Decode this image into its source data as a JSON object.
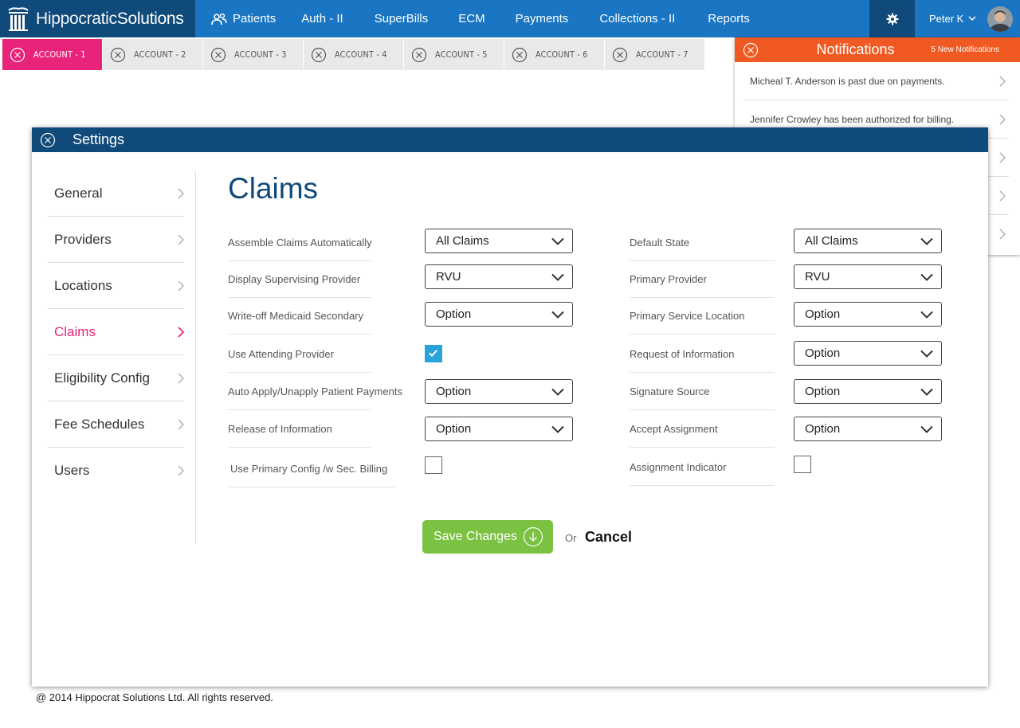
{
  "brand": {
    "name_light": "Hippocratic",
    "name_bold": "Solutions"
  },
  "nav": {
    "items": [
      {
        "label": "Patients",
        "icon": "users-icon"
      },
      {
        "label": "Auth - II"
      },
      {
        "label": "SuperBills"
      },
      {
        "label": "ECM"
      },
      {
        "label": "Payments"
      },
      {
        "label": "Collections - II"
      },
      {
        "label": "Reports"
      }
    ],
    "settings_icon": "gear-icon",
    "user_name": "Peter K"
  },
  "account_tabs": [
    {
      "label": "ACCOUNT - 1",
      "active": true
    },
    {
      "label": "ACCOUNT - 2"
    },
    {
      "label": "ACCOUNT - 3"
    },
    {
      "label": "ACCOUNT - 4"
    },
    {
      "label": "ACCOUNT - 5"
    },
    {
      "label": "ACCOUNT - 6"
    },
    {
      "label": "ACCOUNT - 7"
    }
  ],
  "notifications": {
    "title": "Notifications",
    "count_label": "5 New Notifications",
    "items": [
      "Micheal T. Anderson is past due on payments.",
      "Jennifer Crowley has been authorized for billing.",
      "",
      "",
      ""
    ]
  },
  "settings": {
    "title": "Settings",
    "menu": [
      {
        "label": "General"
      },
      {
        "label": "Providers"
      },
      {
        "label": "Locations"
      },
      {
        "label": "Claims",
        "active": true
      },
      {
        "label": "Eligibility Config"
      },
      {
        "label": "Fee Schedules"
      },
      {
        "label": "Users"
      }
    ],
    "heading": "Claims",
    "left_fields": [
      {
        "label": "Assemble Claims Automatically",
        "type": "select",
        "value": "All Claims"
      },
      {
        "label": "Display Supervising Provider",
        "type": "select",
        "value": "RVU"
      },
      {
        "label": "Write-off Medicaid Secondary",
        "type": "select",
        "value": "Option"
      },
      {
        "label": "Use Attending Provider",
        "type": "checkbox",
        "checked": true
      },
      {
        "label": "Auto Apply/Unapply Patient Payments",
        "type": "select",
        "value": "Option"
      },
      {
        "label": "Release of Information",
        "type": "select",
        "value": "Option"
      },
      {
        "label": "Use Primary Config /w Sec. Billing",
        "type": "checkbox",
        "checked": false
      }
    ],
    "right_fields": [
      {
        "label": "Default State",
        "type": "select",
        "value": "All Claims"
      },
      {
        "label": "Primary Provider",
        "type": "select",
        "value": "RVU"
      },
      {
        "label": "Primary Service Location",
        "type": "select",
        "value": "Option"
      },
      {
        "label": "Request of Information",
        "type": "select",
        "value": "Option"
      },
      {
        "label": "Signature Source",
        "type": "select",
        "value": "Option"
      },
      {
        "label": "Accept Assignment",
        "type": "select",
        "value": "Option"
      },
      {
        "label": "Assignment Indicator",
        "type": "checkbox",
        "checked": false
      }
    ],
    "save_label": "Save Changes",
    "or_label": "Or",
    "cancel_label": "Cancel"
  },
  "footer": {
    "copyright": "@ 2014 Hippocrat Solutions Ltd. All rights reserved."
  },
  "colors": {
    "nav_blue": "#1a76c2",
    "dark_blue": "#0f4a7a",
    "accent_pink": "#e8247a",
    "notification_orange": "#f05a22",
    "save_green": "#7bc142",
    "checkbox_blue": "#2aa3dd"
  }
}
